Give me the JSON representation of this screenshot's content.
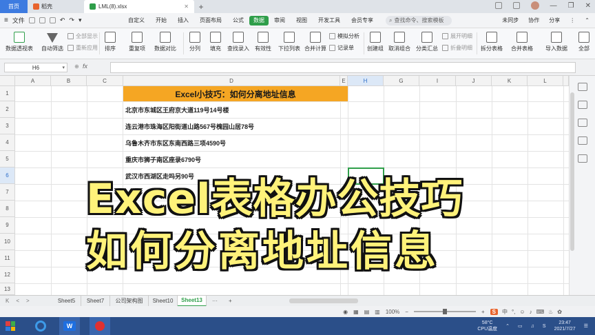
{
  "tabs": {
    "home": "首页",
    "doc": "稻壳",
    "file": "LML(8).xlsx",
    "add": "+"
  },
  "menu": {
    "file": "文件",
    "items": [
      "自定义",
      "开始",
      "插入",
      "页面布局",
      "公式",
      "数据",
      "审阅",
      "视图",
      "开发工具",
      "会员专享"
    ],
    "active_index": 5,
    "search": "查找命令、搜索模板",
    "sync": "未同步",
    "collab": "协作",
    "share": "分享"
  },
  "ribbon": {
    "pivot": "数据透视表",
    "autofilter": "自动筛选",
    "show_all": "全部显示",
    "reapply": "重新应用",
    "sort": "排序",
    "duplicates": "重复项",
    "compare": "数据对比",
    "split": "分列",
    "fill": "填充",
    "lookup_entry": "查找录入",
    "validity": "有效性",
    "dropdown": "下拉列表",
    "consolidate": "合并计算",
    "simulate": "模拟分析",
    "record": "记录单",
    "group": "创建组",
    "ungroup": "取消组合",
    "subtotal": "分类汇总",
    "expand": "展开明细",
    "collapse": "折叠明细",
    "split_table": "拆分表格",
    "merge_table": "合并表格",
    "import": "导入数据",
    "all": "全部"
  },
  "formula_bar": {
    "cell_ref": "H6",
    "fx": "fx",
    "value": ""
  },
  "columns": [
    "A",
    "B",
    "C",
    "D",
    "E",
    "H",
    "G",
    "I",
    "J",
    "K",
    "L",
    "M"
  ],
  "selected_column": "H",
  "rows": [
    "1",
    "2",
    "3",
    "4",
    "5",
    "6",
    "7",
    "8",
    "9",
    "10",
    "11",
    "12",
    "13"
  ],
  "selected_row": "6",
  "sheet": {
    "title": "Excel小技巧：如何分离地址信息",
    "addresses": [
      "北京市东城区王府京大道119号14号楼",
      "连云港市珠海区阳街道山路567号槐园山居78号",
      "乌鲁木齐市东区东南西路三项4590号",
      "重庆市狮子南区座录6790号",
      "武汉市西湖区走吗另90号"
    ]
  },
  "overlay": {
    "line1": "Excel表格办公技巧",
    "line2": "如何分离地址信息"
  },
  "sheet_tabs": [
    "Sheet5",
    "Sheet7",
    "公司架构图",
    "Sheet10",
    "Sheet13"
  ],
  "active_sheet": "Sheet13",
  "status": {
    "zoom": "100%",
    "ime": "中"
  },
  "taskbar": {
    "temp": "58°C",
    "cpu": "CPU温度",
    "time": "23:47",
    "date": "2021/7/27"
  },
  "colors": {
    "accent": "#2f9e4a",
    "title_fill": "#f5a623",
    "caption": "#fff27a"
  }
}
